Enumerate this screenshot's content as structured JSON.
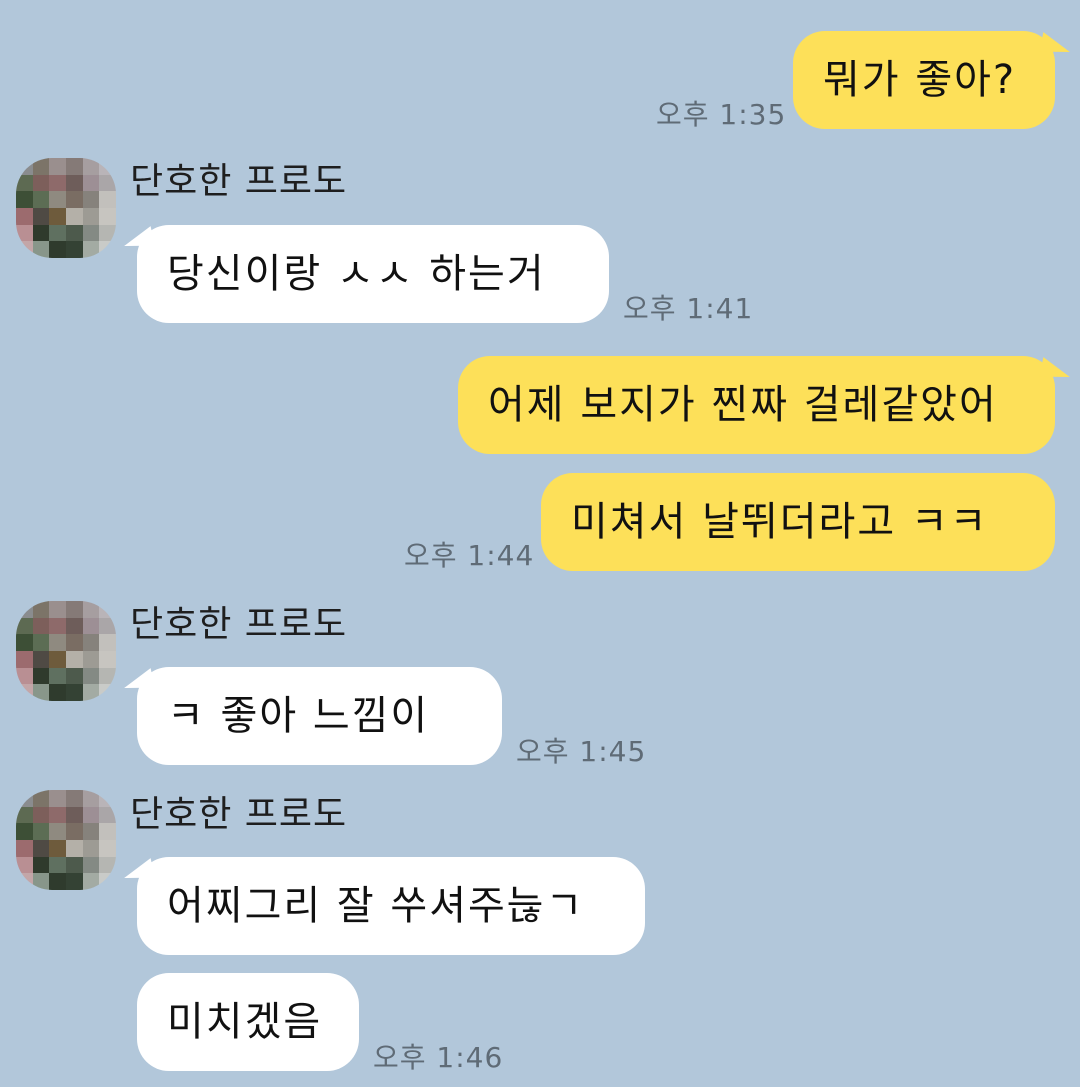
{
  "chat": {
    "sender_name": "단호한 프로도",
    "messages": [
      {
        "direction": "out",
        "text": "뭐가 좋아?",
        "time": "오후 1:35"
      },
      {
        "direction": "in",
        "text": "당신이랑 ㅅㅅ 하는거",
        "time": "오후 1:41"
      },
      {
        "direction": "out",
        "text": "어제 보지가 찐짜 걸레같았어",
        "time": ""
      },
      {
        "direction": "out",
        "text": "미쳐서 날뛰더라고 ㅋㅋ",
        "time": "오후 1:44"
      },
      {
        "direction": "in",
        "text": "ㅋ 좋아 느낌이",
        "time": "오후 1:45"
      },
      {
        "direction": "in",
        "text": "어찌그리 잘 쑤셔주늖ㄱ",
        "time": ""
      },
      {
        "direction": "in",
        "text": "미치겠음",
        "time": "오후 1:46"
      }
    ]
  },
  "colors": {
    "background": "#b2c7da",
    "outgoing_bubble": "#fde059",
    "incoming_bubble": "#ffffff",
    "timestamp": "#5f6b76"
  }
}
